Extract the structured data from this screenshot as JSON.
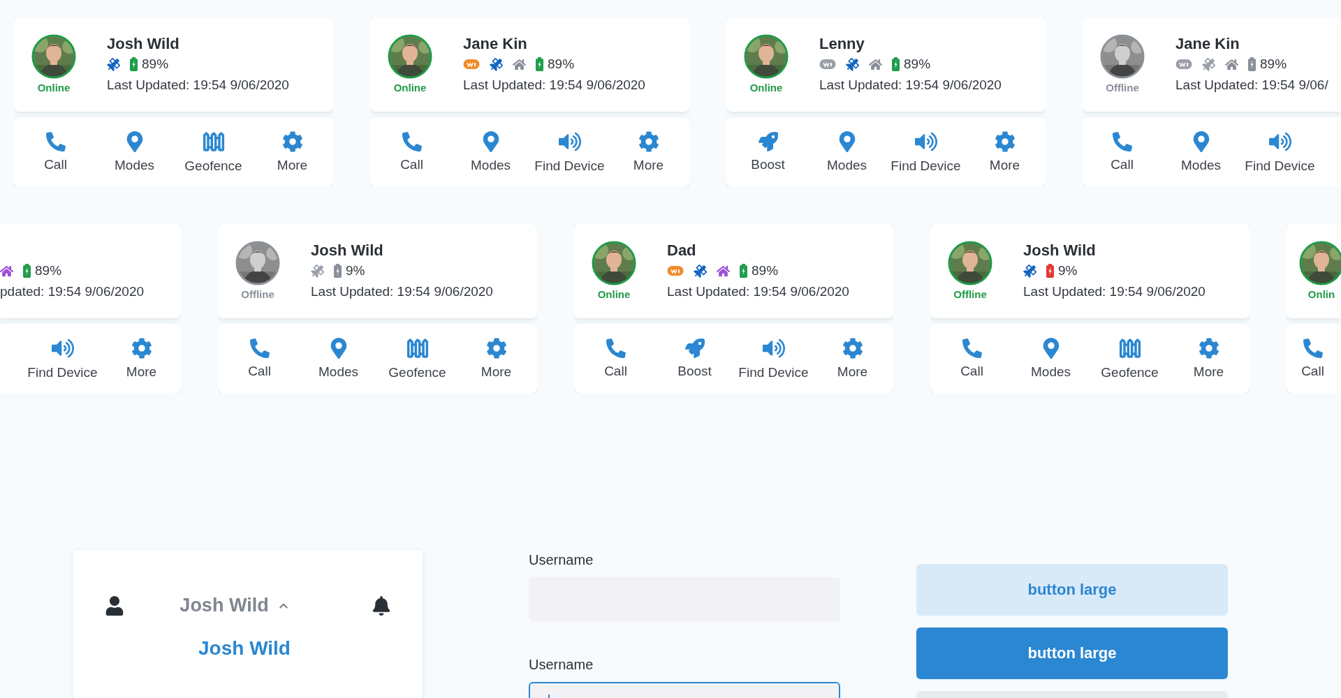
{
  "device_rows": [
    {
      "cards": [
        {
          "kind": "full",
          "avatar": {
            "grayscale": false
          },
          "status": {
            "label": "Online",
            "color": "#1f9a48"
          },
          "name": "Josh Wild",
          "indicators": [
            {
              "kind": "gps",
              "color": "#1565c0"
            }
          ],
          "battery": {
            "color": "#1f9d4c",
            "reading": "89%"
          },
          "updated": "Last Updated: 19:54 9/06/2020",
          "actions": [
            {
              "kind": "call",
              "label": "Call"
            },
            {
              "kind": "modes",
              "label": "Modes"
            },
            {
              "kind": "geofence",
              "label": "Geofence"
            },
            {
              "kind": "more",
              "label": "More"
            }
          ]
        },
        {
          "kind": "full",
          "avatar": {
            "grayscale": false
          },
          "status": {
            "label": "Online",
            "color": "#1f9a48"
          },
          "name": "Jane Kin",
          "indicators": [
            {
              "kind": "wifi",
              "color": "#f08c2a"
            },
            {
              "kind": "gps",
              "color": "#1565c0"
            },
            {
              "kind": "home",
              "color": "#8a9099"
            }
          ],
          "battery": {
            "color": "#1f9d4c",
            "reading": "89%"
          },
          "updated": "Last Updated: 19:54 9/06/2020",
          "actions": [
            {
              "kind": "call",
              "label": "Call"
            },
            {
              "kind": "modes",
              "label": "Modes"
            },
            {
              "kind": "find",
              "label": "Find Device"
            },
            {
              "kind": "more",
              "label": "More"
            }
          ]
        },
        {
          "kind": "full",
          "avatar": {
            "grayscale": false
          },
          "status": {
            "label": "Online",
            "color": "#1f9a48"
          },
          "name": "Lenny",
          "indicators": [
            {
              "kind": "wifi",
              "color": "#9aa0a8"
            },
            {
              "kind": "gps",
              "color": "#1565c0"
            },
            {
              "kind": "home",
              "color": "#8a9099"
            }
          ],
          "battery": {
            "color": "#1f9d4c",
            "reading": "89%"
          },
          "updated": "Last Updated: 19:54 9/06/2020",
          "actions": [
            {
              "kind": "boost",
              "label": "Boost"
            },
            {
              "kind": "modes",
              "label": "Modes"
            },
            {
              "kind": "find",
              "label": "Find Device"
            },
            {
              "kind": "more",
              "label": "More"
            }
          ]
        },
        {
          "kind": "cut-right",
          "avatar": {
            "grayscale": true
          },
          "status": {
            "label": "Offline",
            "color": "#8a9099"
          },
          "name": "Jane Kin",
          "indicators": [
            {
              "kind": "wifi",
              "color": "#9aa0a8"
            },
            {
              "kind": "gps",
              "color": "#9aa0a8"
            },
            {
              "kind": "home",
              "color": "#8a9099"
            }
          ],
          "battery": {
            "color": "#8a9099",
            "reading": "89%"
          },
          "updated": "Last Updated: 19:54 9/06/",
          "actions": [
            {
              "kind": "call",
              "label": "Call"
            },
            {
              "kind": "modes",
              "label": "Modes"
            },
            {
              "kind": "find",
              "label": "Find Device"
            }
          ]
        }
      ]
    },
    {
      "cards": [
        {
          "kind": "cut-left",
          "indicators": [
            {
              "kind": "home",
              "color": "#9b4fd6"
            }
          ],
          "battery": {
            "color": "#1f9d4c",
            "reading": "89%"
          },
          "updated": "pdated: 19:54 9/06/2020",
          "actions": [
            {
              "kind": "find",
              "label": "Find Device"
            },
            {
              "kind": "more",
              "label": "More"
            }
          ]
        },
        {
          "kind": "full",
          "avatar": {
            "grayscale": true
          },
          "status": {
            "label": "Offline",
            "color": "#8a9099"
          },
          "name": "Josh Wild",
          "indicators": [
            {
              "kind": "gps",
              "color": "#9aa0a8"
            }
          ],
          "battery": {
            "color": "#8a9099",
            "reading": "9%"
          },
          "updated": "Last Updated: 19:54 9/06/2020",
          "actions": [
            {
              "kind": "call",
              "label": "Call"
            },
            {
              "kind": "modes",
              "label": "Modes"
            },
            {
              "kind": "geofence",
              "label": "Geofence"
            },
            {
              "kind": "more",
              "label": "More"
            }
          ]
        },
        {
          "kind": "full",
          "avatar": {
            "grayscale": false
          },
          "status": {
            "label": "Online",
            "color": "#1f9a48"
          },
          "name": "Dad",
          "indicators": [
            {
              "kind": "wifi",
              "color": "#f08c2a"
            },
            {
              "kind": "gps",
              "color": "#1565c0"
            },
            {
              "kind": "home",
              "color": "#9b4fd6"
            }
          ],
          "battery": {
            "color": "#1f9d4c",
            "reading": "89%"
          },
          "updated": "Last Updated: 19:54 9/06/2020",
          "actions": [
            {
              "kind": "call",
              "label": "Call"
            },
            {
              "kind": "boost",
              "label": "Boost"
            },
            {
              "kind": "find",
              "label": "Find Device"
            },
            {
              "kind": "more",
              "label": "More"
            }
          ]
        },
        {
          "kind": "full",
          "avatar": {
            "grayscale": false
          },
          "status": {
            "label": "Offline",
            "color": "#1f9a48"
          },
          "name": "Josh Wild",
          "indicators": [
            {
              "kind": "gps",
              "color": "#1565c0"
            }
          ],
          "battery": {
            "color": "#e53935",
            "reading": "9%"
          },
          "updated": "Last Updated: 19:54 9/06/2020",
          "actions": [
            {
              "kind": "call",
              "label": "Call"
            },
            {
              "kind": "modes",
              "label": "Modes"
            },
            {
              "kind": "geofence",
              "label": "Geofence"
            },
            {
              "kind": "more",
              "label": "More"
            }
          ]
        },
        {
          "kind": "cut-right",
          "avatar": {
            "grayscale": false
          },
          "status": {
            "label": "Onlin",
            "color": "#1f9a48"
          },
          "actions": [
            {
              "kind": "call",
              "label": "Call"
            }
          ]
        }
      ]
    }
  ],
  "profile_menu": {
    "current": "Josh Wild",
    "expanded": true,
    "items": [
      {
        "label": "Josh Wild",
        "selected": true
      }
    ]
  },
  "form_fields": [
    {
      "label": "Username",
      "focused": false
    },
    {
      "label": "Username",
      "focused": true
    }
  ],
  "buttons": [
    {
      "kind": "light",
      "label": "button large"
    },
    {
      "kind": "primary",
      "label": "button large"
    },
    {
      "kind": "secondary"
    }
  ]
}
